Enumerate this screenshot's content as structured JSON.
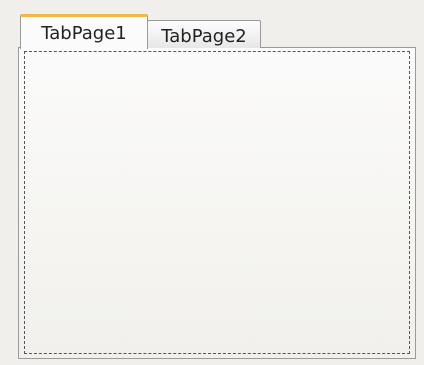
{
  "tab_control": {
    "tabs": [
      {
        "label": "TabPage1",
        "selected": true
      },
      {
        "label": "TabPage2",
        "selected": false
      }
    ],
    "colors": {
      "window_background": "#f0efec",
      "selected_tab_indicator": "#f4b64a",
      "border": "#9a9a9a"
    }
  }
}
